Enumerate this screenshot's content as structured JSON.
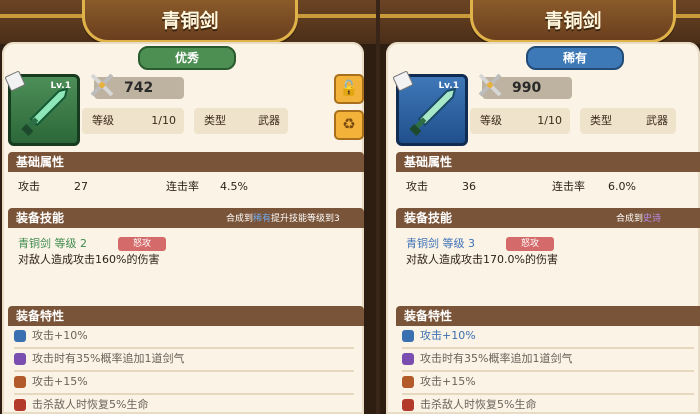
{
  "left": {
    "title": "青铜剑",
    "rarity": "优秀",
    "level_badge": "Lv.1",
    "power": "742",
    "stats": {
      "level_label": "等级",
      "level_value": "1/10",
      "type_label": "类型",
      "type_value": "武器"
    },
    "base_section": "基础属性",
    "attack_label": "攻击",
    "attack_value": "27",
    "combo_label": "连击率",
    "combo_value": "4.5%",
    "skill_section": "装备技能",
    "skill_note": "合成到",
    "skill_note_level": "稀有",
    "skill_note_2": "提升技能等级到3",
    "skill_name": "青铜剑 等级 2",
    "skill_tag": "怒攻",
    "skill_desc": "对敌人造成攻击160%的伤害",
    "trait_section": "装备特性",
    "traits": [
      {
        "text": "攻击+10%",
        "color": "#3a6fb0"
      },
      {
        "text": "攻击时有35%概率追加1道剑气",
        "color": "#7a4fb0"
      },
      {
        "text": "攻击+15%",
        "color": "#b35a2a"
      },
      {
        "text": "击杀敌人时恢复5%生命",
        "color": "#b33a2a"
      }
    ],
    "buttons": {
      "unlock": "🔓",
      "recycle": "♻"
    }
  },
  "right": {
    "title": "青铜剑",
    "rarity": "稀有",
    "level_badge": "Lv.1",
    "power": "990",
    "stats": {
      "level_label": "等级",
      "level_value": "1/10",
      "type_label": "类型",
      "type_value": "武器"
    },
    "base_section": "基础属性",
    "attack_label": "攻击",
    "attack_value": "36",
    "combo_label": "连击率",
    "combo_value": "6.0%",
    "skill_section": "装备技能",
    "skill_note": "合成到",
    "skill_note_level": "史诗",
    "skill_name": "青铜剑 等级 3",
    "skill_tag": "怒攻",
    "skill_desc": "对敌人造成攻击170.0%的伤害",
    "trait_section": "装备特性",
    "traits": [
      {
        "text": "攻击+10%",
        "color": "#3a6fb0"
      },
      {
        "text": "攻击时有35%概率追加1道剑气",
        "color": "#7a4fb0"
      },
      {
        "text": "攻击+15%",
        "color": "#b35a2a"
      },
      {
        "text": "击杀敌人时恢复5%生命",
        "color": "#b33a2a"
      }
    ]
  }
}
